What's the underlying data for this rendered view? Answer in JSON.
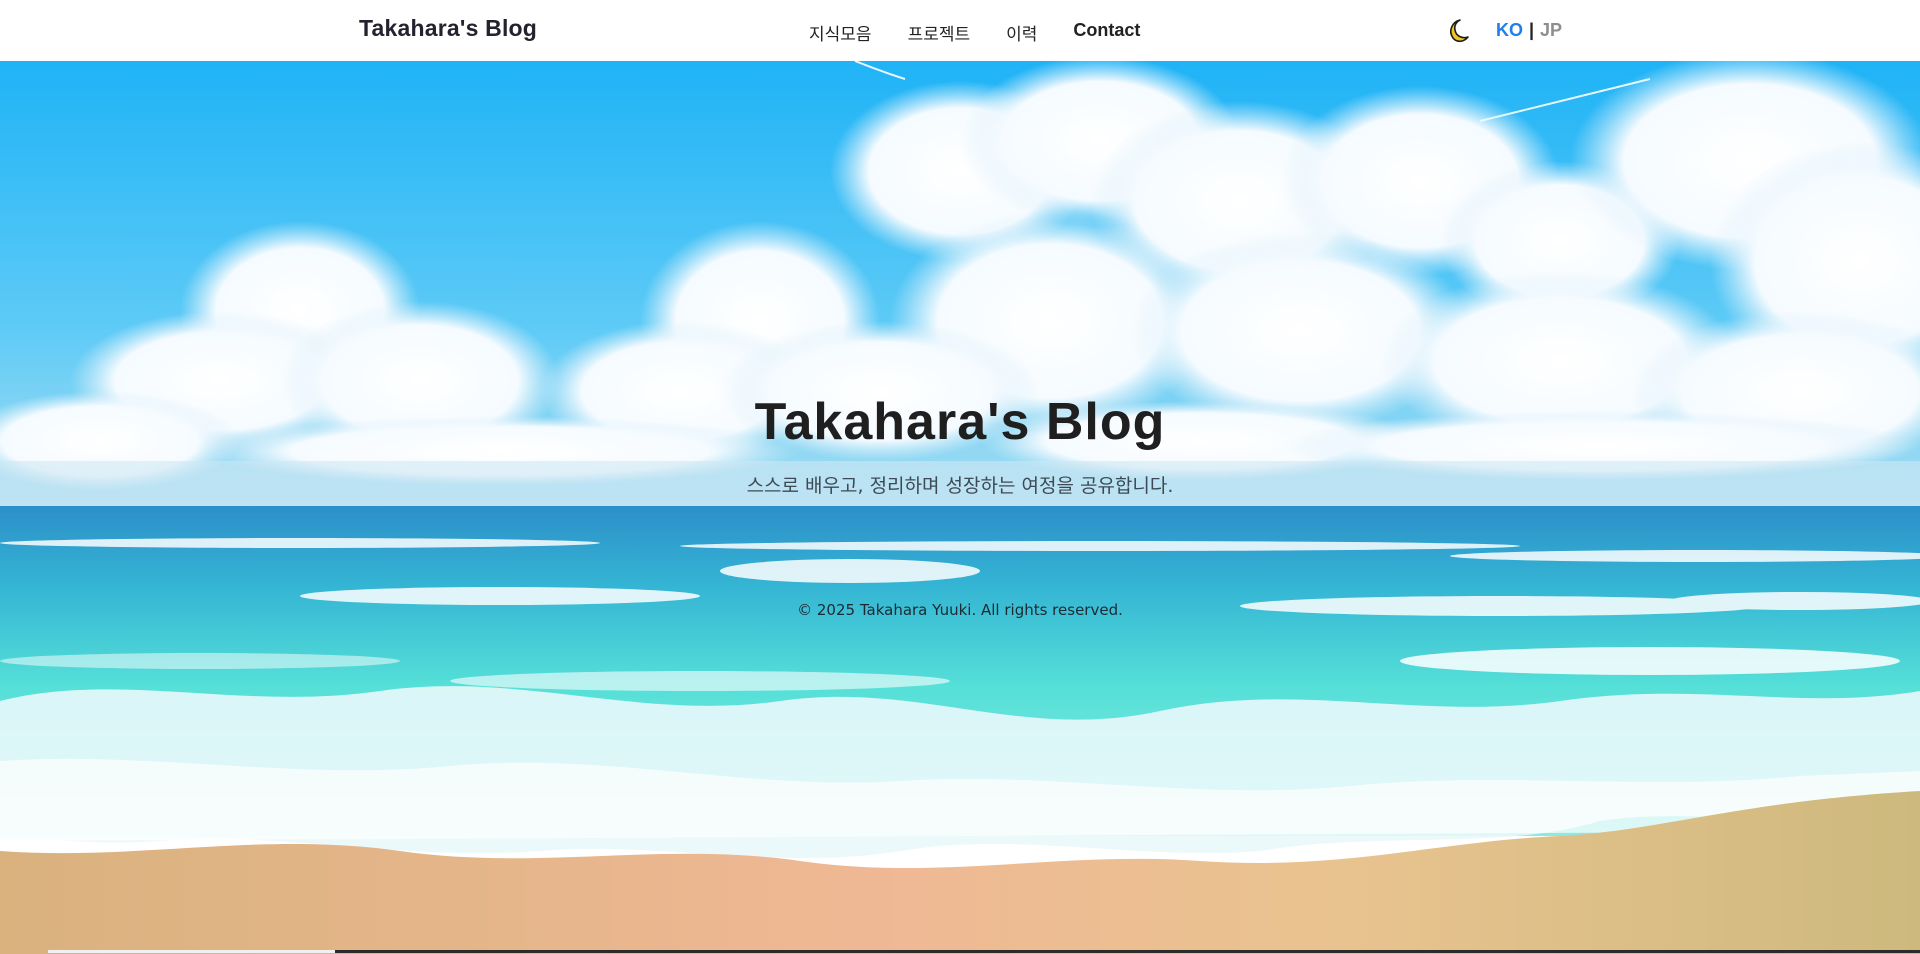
{
  "header": {
    "brand": "Takahara's Blog",
    "nav": [
      {
        "label": "지식모음"
      },
      {
        "label": "프로젝트"
      },
      {
        "label": "이력"
      },
      {
        "label": "Contact"
      }
    ],
    "theme_icon": "moon-icon",
    "lang": {
      "ko": "KO",
      "separator": "|",
      "jp": "JP",
      "active": "KO"
    }
  },
  "hero": {
    "title": "Takahara's Blog",
    "subtitle": "스스로 배우고, 정리하며 성장하는 여정을 공유합니다.",
    "copyright": "© 2025 Takahara Yuuki. All rights reserved."
  },
  "colors": {
    "accent": "#1f7ef0",
    "sky_top": "#22b6f5",
    "sea": "#3fcfd0",
    "sand": "#d8b884"
  }
}
